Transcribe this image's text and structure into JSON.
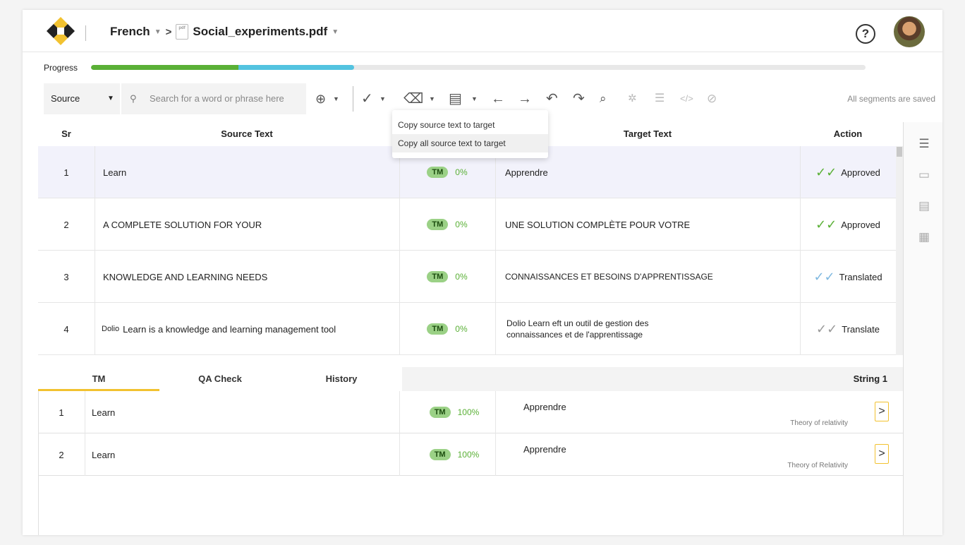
{
  "header": {
    "language": "French",
    "file_name": "Social_experiments.pdf",
    "help_label": "?"
  },
  "progress": {
    "label": "Progress",
    "approved_fraction": 0.19,
    "translated_fraction": 0.15,
    "colors": {
      "approved": "#5ab036",
      "translated": "#53c3e0",
      "remaining": "#e8e8e8"
    }
  },
  "toolbar": {
    "source_select": "Source",
    "search_placeholder": "Search for a word or phrase here",
    "status": "All segments are saved",
    "icons": [
      "download-icon",
      "check-icon",
      "copy-eraser-icon",
      "document-icon",
      "arrow-left-icon",
      "arrow-right-icon",
      "undo-icon",
      "redo-icon",
      "find-replace-icon",
      "special-chars-icon",
      "align-icon",
      "code-tags-icon",
      "hide-icon"
    ]
  },
  "copy_menu": {
    "items": [
      "Copy source text to target",
      "Copy all source text to target"
    ]
  },
  "table": {
    "headers": {
      "sr": "Sr",
      "source": "Source Text",
      "target": "Target Text",
      "action": "Action"
    },
    "rows": [
      {
        "sr": "1",
        "source": "Learn",
        "match": "TM",
        "pct": "0%",
        "target": "Apprendre",
        "status": "Approved",
        "status_color": "#5ab036"
      },
      {
        "sr": "2",
        "source": "A COMPLETE SOLUTION FOR YOUR",
        "match": "TM",
        "pct": "0%",
        "target": "UNE SOLUTION COMPLÈTE POUR VOTRE",
        "status": "Approved",
        "status_color": "#5ab036"
      },
      {
        "sr": "3",
        "source": "KNOWLEDGE AND LEARNING NEEDS",
        "match": "TM",
        "pct": "0%",
        "target": "CONNAISSANCES ET BESOINS D'APPRENTISSAGE",
        "status": "Translated",
        "status_color": "#7fb8e0"
      },
      {
        "sr": "4",
        "source_prefix": "Dolio",
        "source": "Learn is a knowledge and learning management tool",
        "match": "TM",
        "pct": "0%",
        "target_line1": "Dolio Learn eft un outil de gestion des",
        "target_line2": "connaissances et de l'apprentissage",
        "status": "Translate",
        "status_color": "#999999"
      }
    ]
  },
  "bottom": {
    "tabs": [
      "TM",
      "QA Check",
      "History"
    ],
    "string_label": "String 1",
    "rows": [
      {
        "sr": "1",
        "source": "Learn",
        "match": "TM",
        "pct": "100%",
        "target": "Apprendre",
        "origin": "Theory of relativity"
      },
      {
        "sr": "2",
        "source": "Learn",
        "match": "TM",
        "pct": "100%",
        "target": "Apprendre",
        "origin": "Theory of Relativity"
      }
    ]
  },
  "side_panel": {
    "icons": [
      "filter-icon",
      "comment-icon",
      "note-icon",
      "calculator-icon"
    ]
  }
}
